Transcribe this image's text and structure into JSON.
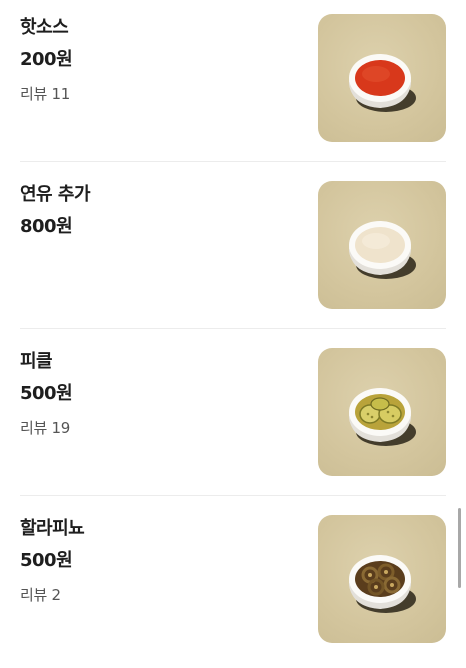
{
  "menu": {
    "items": [
      {
        "name": "핫소스",
        "price": "200원",
        "review": "리뷰 11",
        "image": "hot-sauce-cup"
      },
      {
        "name": "연유 추가",
        "price": "800원",
        "review": "",
        "image": "condensed-milk-cup"
      },
      {
        "name": "피클",
        "price": "500원",
        "review": "리뷰 19",
        "image": "pickle-cup"
      },
      {
        "name": "할라피뇨",
        "price": "500원",
        "review": "리뷰 2",
        "image": "jalapeno-cup"
      }
    ]
  },
  "colors": {
    "thumbnail_background": "#d6c9a3",
    "hot_sauce": "#d8381b",
    "condensed_milk": "#efe3cc",
    "pickle": "#c9b53a",
    "jalapeno": "#6b4a22"
  }
}
